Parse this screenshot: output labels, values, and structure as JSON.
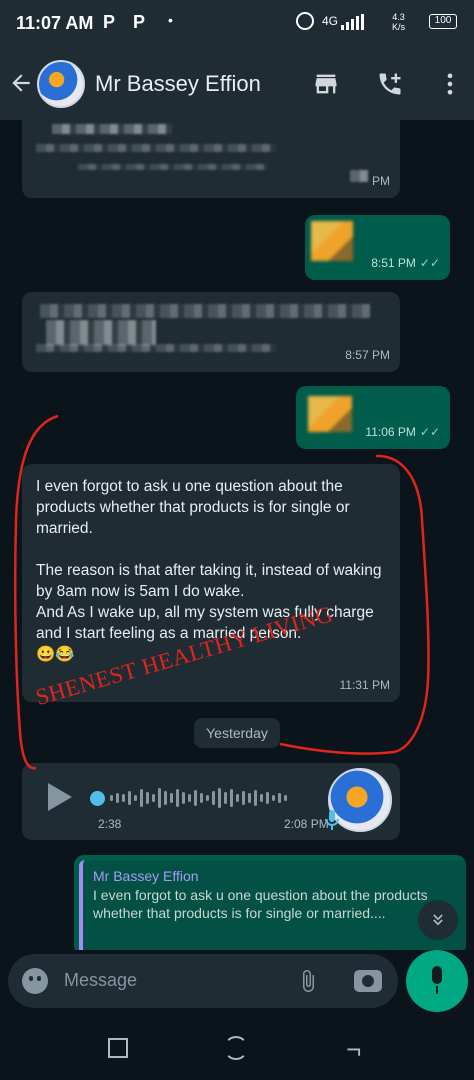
{
  "status_bar": {
    "time": "11:07 AM",
    "notif_1": "P",
    "notif_2": "P",
    "dot": "•",
    "network": "4G",
    "speed_top": "4.3",
    "speed_bottom": "K/s",
    "battery": "100"
  },
  "header": {
    "contact_name": "Mr Bassey Effion",
    "icons": [
      "back-arrow-icon",
      "avatar",
      "shop-icon",
      "add-call-icon",
      "more-vert-icon"
    ]
  },
  "messages": [
    {
      "direction": "in",
      "time": "PM",
      "redacted": true
    },
    {
      "direction": "out",
      "time": "8:51 PM",
      "sticker": true,
      "status": "read"
    },
    {
      "direction": "in",
      "time": "8:57 PM",
      "redacted": true
    },
    {
      "direction": "out",
      "time": "11:06 PM",
      "sticker": true,
      "status": "read"
    },
    {
      "direction": "in",
      "time": "11:31 PM",
      "text": "I even forgot to ask u one question about the products whether that products is for single or married.\n\nThe reason is that after  taking it, instead of waking by 8am  now is 5am I do wake.\n And As I wake up, all my system was fully charge and I start feeling as a married person.\n😀😂"
    }
  ],
  "date_divider": "Yesterday",
  "voice_note": {
    "duration": "2:38",
    "time": "2:08 PM"
  },
  "reply": {
    "quoted_name": "Mr Bassey Effion",
    "quoted_text": "I even forgot to ask u one question about the products whether that products is for single or married...."
  },
  "annotation": {
    "stamp": "SHENEST HEALTHY LIVING",
    "color": "#e0251c"
  },
  "composer": {
    "placeholder": "Message"
  },
  "colors": {
    "incoming": "#1f2c34",
    "outgoing": "#005c4b",
    "accent": "#00a884",
    "background": "#0b141a"
  }
}
